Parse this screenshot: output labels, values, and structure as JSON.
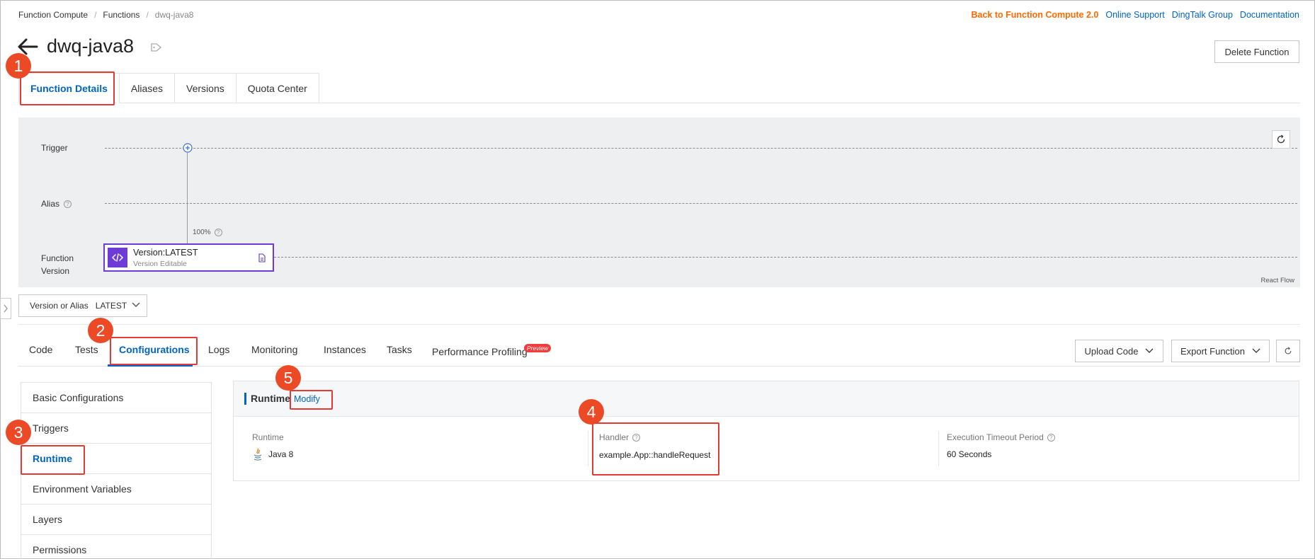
{
  "breadcrumb": [
    "Function Compute",
    "Functions",
    "dwq-java8"
  ],
  "top_links": {
    "back": "Back to Function Compute 2.0",
    "support": "Online Support",
    "dingtalk": "DingTalk Group",
    "docs": "Documentation"
  },
  "header": {
    "title": "dwq-java8",
    "delete_label": "Delete Function"
  },
  "tabs_top": [
    "Function Details",
    "Aliases",
    "Versions",
    "Quota Center"
  ],
  "flow": {
    "trigger_label": "Trigger",
    "alias_label": "Alias",
    "version_label_1": "Function",
    "version_label_2": "Version",
    "weight": "100%",
    "node_title": "Version:LATEST",
    "node_sub": "Version Editable",
    "watermark": "React Flow"
  },
  "version_select": {
    "label": "Version or Alias",
    "value": "LATEST"
  },
  "tabs2": [
    "Code",
    "Tests",
    "Configurations",
    "Logs",
    "Monitoring",
    "Instances",
    "Tasks",
    "Performance Profiling"
  ],
  "preview_badge": "Preview",
  "actions": {
    "upload": "Upload Code",
    "export": "Export Function"
  },
  "menu": [
    "Basic Configurations",
    "Triggers",
    "Runtime",
    "Environment Variables",
    "Layers",
    "Permissions"
  ],
  "runtime_panel": {
    "title": "Runtime",
    "modify": "Modify",
    "fields": [
      {
        "label": "Runtime",
        "value": "Java 8"
      },
      {
        "label": "Handler",
        "value": "example.App::handleRequest"
      },
      {
        "label": "Execution Timeout Period",
        "value": "60 Seconds"
      }
    ]
  },
  "annotations": [
    "1",
    "2",
    "3",
    "4",
    "5"
  ],
  "colors": {
    "accent": "#0064c8",
    "orange": "#ff6a00",
    "purple": "#6e3ad8",
    "annotation_red": "#e53935"
  }
}
